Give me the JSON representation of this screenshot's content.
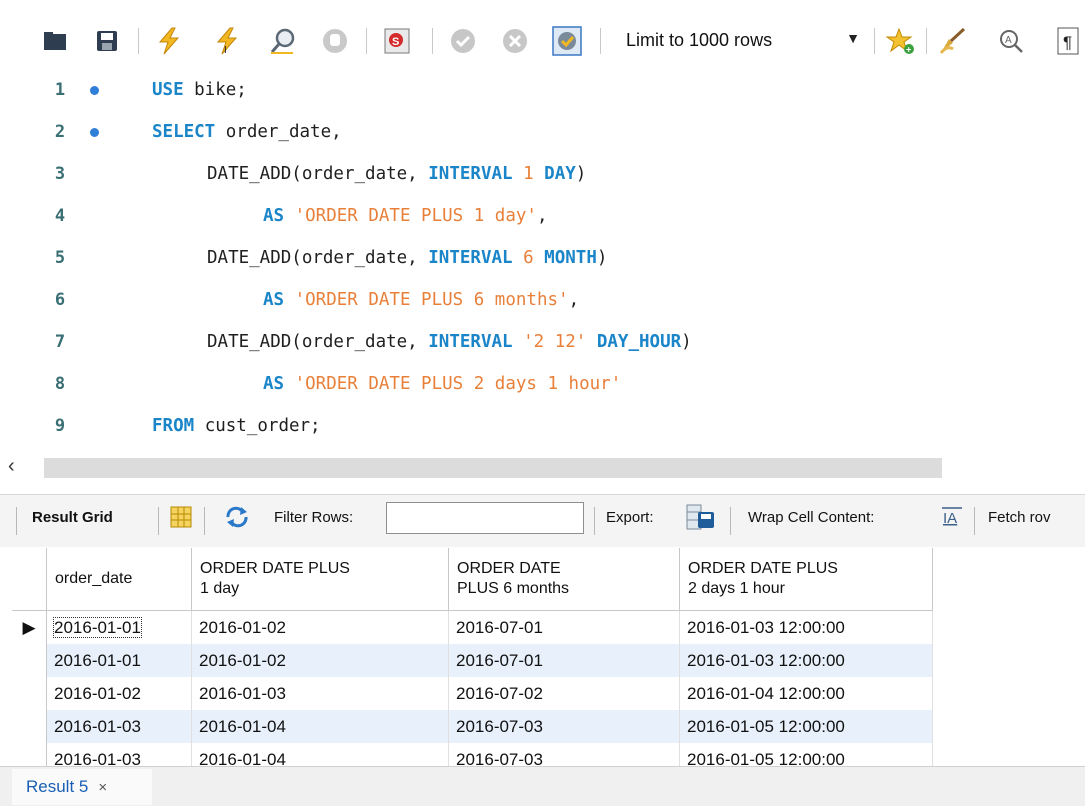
{
  "toolbar": {
    "limit_label": "Limit to 1000 rows",
    "icons": [
      "open-folder-icon",
      "save-icon",
      "execute-icon",
      "execute-current-icon",
      "explain-icon",
      "stop-icon",
      "toggle-error-icon",
      "commit-icon",
      "rollback-icon",
      "autocommit-icon",
      "dropdown-icon",
      "bookmark-add-icon",
      "beautify-icon",
      "find-icon",
      "invisible-chars-icon"
    ]
  },
  "editor": {
    "lines": [
      {
        "n": "1",
        "dot": true
      },
      {
        "n": "2",
        "dot": true
      },
      {
        "n": "3",
        "dot": false
      },
      {
        "n": "4",
        "dot": false
      },
      {
        "n": "5",
        "dot": false
      },
      {
        "n": "6",
        "dot": false
      },
      {
        "n": "7",
        "dot": false
      },
      {
        "n": "8",
        "dot": false
      },
      {
        "n": "9",
        "dot": false
      }
    ],
    "code": {
      "l1_kw": "USE",
      "l1_rest": " bike;",
      "l2_kw": "SELECT",
      "l2_rest": " order_date,",
      "l3_fn": "DATE_ADD(order_date, ",
      "l3_kw1": "INTERVAL",
      "l3_num": " 1 ",
      "l3_kw2": "DAY",
      "l3_end": ")",
      "l4_kw": "AS",
      "l4_str": " 'ORDER DATE PLUS 1 day'",
      "l4_end": ",",
      "l5_fn": "DATE_ADD(order_date, ",
      "l5_kw1": "INTERVAL",
      "l5_num": " 6 ",
      "l5_kw2": "MONTH",
      "l5_end": ")",
      "l6_kw": "AS",
      "l6_str": " 'ORDER DATE PLUS 6 months'",
      "l6_end": ",",
      "l7_fn": "DATE_ADD(order_date, ",
      "l7_kw1": "INTERVAL",
      "l7_num": " '2 12' ",
      "l7_kw2": "DAY_HOUR",
      "l7_end": ")",
      "l8_kw": "AS",
      "l8_str": " 'ORDER DATE PLUS 2 days 1 hour'",
      "l9_kw": "FROM",
      "l9_rest": " cust_order;"
    }
  },
  "results_toolbar": {
    "result_grid": "Result Grid",
    "filter_rows": "Filter Rows:",
    "export": "Export:",
    "wrap": "Wrap Cell Content:",
    "fetch": "Fetch rov"
  },
  "grid": {
    "headers": [
      {
        "l1": "order_date",
        "l2": ""
      },
      {
        "l1": "ORDER DATE PLUS",
        "l2": "1 day"
      },
      {
        "l1": "ORDER DATE",
        "l2": "PLUS 6 months"
      },
      {
        "l1": "ORDER DATE PLUS",
        "l2": "2 days 1 hour"
      }
    ],
    "rows": [
      [
        "2016-01-01",
        "2016-01-02",
        "2016-07-01",
        "2016-01-03 12:00:00"
      ],
      [
        "2016-01-01",
        "2016-01-02",
        "2016-07-01",
        "2016-01-03 12:00:00"
      ],
      [
        "2016-01-02",
        "2016-01-03",
        "2016-07-02",
        "2016-01-04 12:00:00"
      ],
      [
        "2016-01-03",
        "2016-01-04",
        "2016-07-03",
        "2016-01-05 12:00:00"
      ],
      [
        "2016-01-03",
        "2016-01-04",
        "2016-07-03",
        "2016-01-05 12:00:00"
      ]
    ]
  },
  "bottom": {
    "tab_label": "Result 5",
    "close": "×"
  }
}
